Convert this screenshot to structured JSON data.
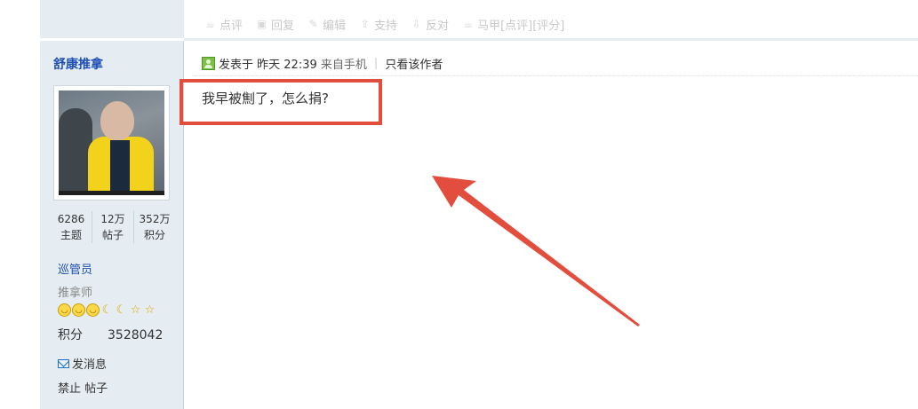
{
  "toolbar": {
    "items": [
      {
        "label": "点评",
        "icon": "comment-icon"
      },
      {
        "label": "回复",
        "icon": "reply-icon"
      },
      {
        "label": "编辑",
        "icon": "edit-icon"
      },
      {
        "label": "支持",
        "icon": "thumbs-up-icon"
      },
      {
        "label": "反对",
        "icon": "thumbs-down-icon"
      },
      {
        "label": "马甲[点评][评分]",
        "icon": "comment-icon"
      }
    ]
  },
  "author": {
    "name": "舒康推拿",
    "stats": [
      {
        "value": "6286",
        "label": "主题"
      },
      {
        "value": "12万",
        "label": "帖子"
      },
      {
        "value": "352万",
        "label": "积分"
      }
    ],
    "role": "巡管员",
    "title": "推拿师",
    "medals": [
      "sun",
      "sun",
      "sun",
      "moon",
      "moon",
      "star",
      "star"
    ],
    "points_label": "积分",
    "points_value": "3528042",
    "send_message": "发消息",
    "ban_post": "禁止 帖子"
  },
  "post": {
    "posted_prefix": "发表于",
    "posted_time": "昨天 22:39",
    "posted_source": "来自手机",
    "only_author": "只看该作者",
    "content": "我早被劁了，怎么捐?"
  },
  "colors": {
    "sidebar_bg": "#e5edf2",
    "link_blue": "#1e4fb4",
    "annotation_red": "#e34d3e"
  }
}
